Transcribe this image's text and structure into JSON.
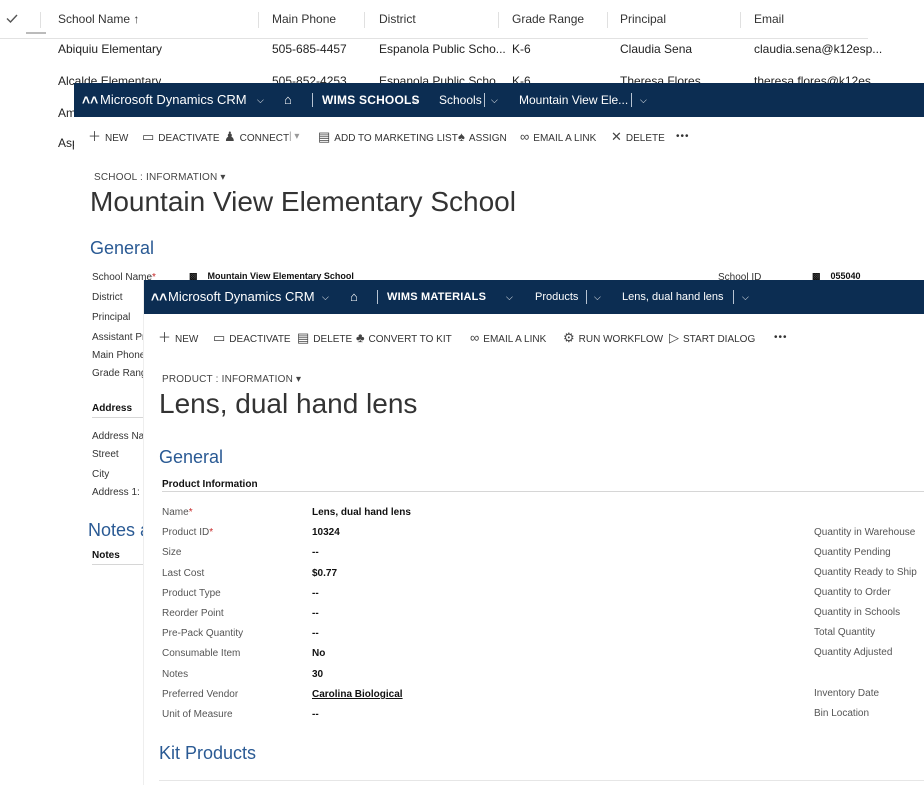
{
  "grid": {
    "columns": [
      "School Name ↑",
      "Main Phone",
      "District",
      "Grade Range",
      "Principal",
      "Email"
    ],
    "rows": [
      [
        "Abiquiu Elementary",
        "505-685-4457",
        "Espanola Public Scho...",
        "K-6",
        "Claudia Sena",
        "claudia.sena@k12esp..."
      ],
      [
        "Alcalde Elementary",
        "505-852-4253",
        "Espanola Public Scho...",
        "K-6",
        "Theresa Flores",
        "theresa.flores@k12es..."
      ],
      [
        "Am",
        "",
        "",
        "",
        "",
        ""
      ],
      [
        "Asp",
        "",
        "",
        "",
        "",
        ""
      ]
    ]
  },
  "school": {
    "nav": {
      "app": "Microsoft Dynamics CRM",
      "area": "WIMS SCHOOLS",
      "entity": "Schools",
      "record": "Mountain View Ele..."
    },
    "commands": [
      "NEW",
      "DEACTIVATE",
      "CONNECT",
      "ADD TO MARKETING LIST",
      "ASSIGN",
      "EMAIL A LINK",
      "DELETE",
      "•••"
    ],
    "crumb": "SCHOOL : INFORMATION",
    "title": "Mountain View Elementary School",
    "general": "General",
    "labels": [
      "School Name",
      "District",
      "Principal",
      "Assistant Pr",
      "Main Phone",
      "Grade Rang"
    ],
    "school_name_value": "Mountain View Elementary School",
    "school_id_label": "School ID",
    "school_id_value": "055040",
    "address_head": "Address",
    "address_labels": [
      "Address Na",
      "Street",
      "City",
      "Address 1: "
    ],
    "notes_title": "Notes a",
    "notes_sub": "Notes"
  },
  "product": {
    "nav": {
      "app": "Microsoft Dynamics CRM",
      "area": "WIMS MATERIALS",
      "entity": "Products",
      "record": "Lens, dual hand lens"
    },
    "commands": [
      "NEW",
      "DEACTIVATE",
      "DELETE",
      "CONVERT TO KIT",
      "EMAIL A LINK",
      "RUN WORKFLOW",
      "START DIALOG",
      "•••"
    ],
    "crumb": "PRODUCT : INFORMATION",
    "title": "Lens, dual hand lens",
    "general": "General",
    "info_head": "Product Information",
    "fields": [
      {
        "label": "Name",
        "value": "Lens, dual hand lens"
      },
      {
        "label": "Product ID",
        "value": "10324"
      },
      {
        "label": "Size",
        "value": "--"
      },
      {
        "label": "Last Cost",
        "value": "$0.77"
      },
      {
        "label": "Product Type",
        "value": "--"
      },
      {
        "label": "Reorder Point",
        "value": "--"
      },
      {
        "label": "Pre-Pack Quantity",
        "value": "--"
      },
      {
        "label": "Consumable Item",
        "value": "No"
      },
      {
        "label": "Notes",
        "value": "30"
      },
      {
        "label": "Preferred Vendor",
        "value": "Carolina Biological"
      },
      {
        "label": "Unit of Measure",
        "value": "--"
      }
    ],
    "right_labels": [
      "Quantity in Warehouse",
      "Quantity Pending",
      "Quantity Ready to Ship",
      "Quantity to Order",
      "Quantity in Schools",
      "Total Quantity",
      "Quantity Adjusted",
      "Inventory Date",
      "Bin Location"
    ],
    "kit_title": "Kit Products"
  },
  "colors": {
    "navbar": "#0c2d52",
    "section": "#2a5a94",
    "required": "#c62828"
  }
}
